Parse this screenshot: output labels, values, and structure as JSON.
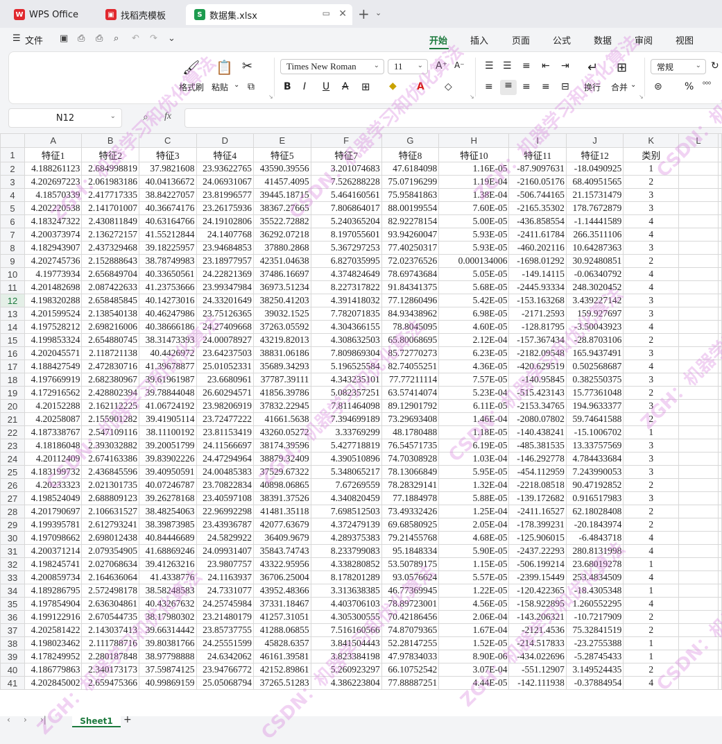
{
  "tabs": [
    {
      "label": "WPS Office",
      "icon": "wps-logo-icon",
      "color": "#e0282e"
    },
    {
      "label": "找稻壳模板",
      "icon": "docer-logo-icon",
      "color": "#e0282e"
    },
    {
      "label": "数据集.xlsx",
      "icon": "spreadsheet-icon",
      "color": "#1d9b4f"
    }
  ],
  "menu": {
    "file": "文件",
    "items": [
      "开始",
      "插入",
      "页面",
      "公式",
      "数据",
      "审阅",
      "视图"
    ],
    "active": "开始"
  },
  "ribbon": {
    "format_painter": "格式刷",
    "paste": "粘贴",
    "font_name": "Times New Roman",
    "font_size": "11",
    "wrap": "换行",
    "merge": "合并",
    "number_format": "常规",
    "percent": "%"
  },
  "formula_bar": {
    "cell_ref": "N12",
    "fx": "fx",
    "value": ""
  },
  "grid": {
    "columns": [
      "A",
      "B",
      "C",
      "D",
      "E",
      "F",
      "G",
      "H",
      "I",
      "J",
      "K",
      "L"
    ],
    "selected_row": 12,
    "rows": [
      [
        "特征1",
        "特征2",
        "特征3",
        "特征4",
        "特征5",
        "特征7",
        "特征8",
        "特征10",
        "特征11",
        "特征12",
        "类别"
      ],
      [
        "4.188261123",
        "2.684998819",
        "37.9821608",
        "23.93622765",
        "43590.39556",
        "3.201074683",
        "47.6184098",
        "1.16E-05",
        "-87.9097631",
        "-18.0490925",
        "1"
      ],
      [
        "4.202697223",
        "2.061983186",
        "40.04136672",
        "24.06931067",
        "41457.4095",
        "7.526288228",
        "75.07196299",
        "1.19E-04",
        "-2160.05176",
        "68.40951565",
        "2"
      ],
      [
        "4.18570339",
        "2.417717335",
        "38.84227057",
        "23.81996577",
        "39445.18715",
        "5.464160561",
        "75.95841863",
        "1.38E-04",
        "-506.744165",
        "21.15731479",
        "3"
      ],
      [
        "4.202220538",
        "2.141701007",
        "40.36674176",
        "23.26175936",
        "38367.27665",
        "7.806864017",
        "88.00199554",
        "7.60E-05",
        "-2165.35302",
        "178.7672879",
        "3"
      ],
      [
        "4.183247322",
        "2.430811849",
        "40.63164766",
        "24.19102806",
        "35522.72882",
        "5.240365204",
        "82.92278154",
        "5.00E-05",
        "-436.858554",
        "-1.14441589",
        "4"
      ],
      [
        "4.200373974",
        "2.136272157",
        "41.55212844",
        "24.1407768",
        "36292.07218",
        "8.197055601",
        "93.94260047",
        "5.93E-05",
        "-2411.61784",
        "266.3511106",
        "4"
      ],
      [
        "4.182943907",
        "2.437329468",
        "39.18225957",
        "23.94684853",
        "37880.2868",
        "5.367297253",
        "77.40250317",
        "5.93E-05",
        "-460.202116",
        "10.64287363",
        "3"
      ],
      [
        "4.202745736",
        "2.152888643",
        "38.78749983",
        "23.18977957",
        "42351.04638",
        "6.827035995",
        "72.02376526",
        "0.000134006",
        "-1698.01292",
        "30.92480851",
        "2"
      ],
      [
        "4.19773934",
        "2.656849704",
        "40.33650561",
        "24.22821369",
        "37486.16697",
        "4.374824649",
        "78.69743684",
        "5.05E-05",
        "-149.14115",
        "-0.06340792",
        "4"
      ],
      [
        "4.201482698",
        "2.087422633",
        "41.23753666",
        "23.99347984",
        "36973.51234",
        "8.227317822",
        "91.84341375",
        "5.68E-05",
        "-2445.93334",
        "248.3020452",
        "4"
      ],
      [
        "4.198320288",
        "2.658485845",
        "40.14273016",
        "24.33201649",
        "38250.41203",
        "4.391418032",
        "77.12860496",
        "5.42E-05",
        "-153.163268",
        "3.439227142",
        "3"
      ],
      [
        "4.201599524",
        "2.138540138",
        "40.46247986",
        "23.75126365",
        "39032.1525",
        "7.782071835",
        "84.93438962",
        "6.98E-05",
        "-2171.2593",
        "159.927697",
        "3"
      ],
      [
        "4.197528212",
        "2.698216006",
        "40.38666186",
        "24.27409668",
        "37263.05592",
        "4.304366155",
        "78.8045095",
        "4.60E-05",
        "-128.81795",
        "-3.50043923",
        "4"
      ],
      [
        "4.199853324",
        "2.654880745",
        "38.31473393",
        "24.00078927",
        "43219.82013",
        "4.308632503",
        "65.80068695",
        "2.12E-04",
        "-157.367434",
        "-28.8703106",
        "2"
      ],
      [
        "4.202045571",
        "2.118721138",
        "40.4426972",
        "23.64237503",
        "38831.06186",
        "7.809869304",
        "85.72770273",
        "6.23E-05",
        "-2182.09548",
        "165.9437491",
        "3"
      ],
      [
        "4.188427549",
        "2.472830716",
        "41.39678877",
        "25.01052331",
        "35689.34293",
        "5.196525584",
        "82.74055251",
        "4.36E-05",
        "-420.629519",
        "0.502568687",
        "4"
      ],
      [
        "4.197669919",
        "2.682380967",
        "39.61961987",
        "23.6680961",
        "37787.39111",
        "4.343235101",
        "77.77211114",
        "7.57E-05",
        "-140.95845",
        "0.382550375",
        "3"
      ],
      [
        "4.172916562",
        "2.428802394",
        "39.78844048",
        "26.60294571",
        "41856.39786",
        "5.082357251",
        "63.57414074",
        "5.23E-04",
        "-515.423143",
        "15.77361048",
        "2"
      ],
      [
        "4.20152288",
        "2.162112225",
        "41.06724192",
        "23.98206919",
        "37832.22945",
        "7.811464098",
        "89.12901792",
        "6.11E-05",
        "-2153.34765",
        "194.9633377",
        "3"
      ],
      [
        "4.20258087",
        "2.155901282",
        "39.41905114",
        "23.72477222",
        "41661.5638",
        "7.394699189",
        "73.29693408",
        "1.46E-04",
        "-2080.07802",
        "59.74641588",
        "2"
      ],
      [
        "4.187338767",
        "2.547109116",
        "38.11100192",
        "23.81153419",
        "43260.05272",
        "3.33769299",
        "48.1780488",
        "1.18E-05",
        "-140.438241",
        "-15.1006702",
        "1"
      ],
      [
        "4.18186048",
        "2.393032882",
        "39.20051799",
        "24.11566697",
        "38174.39596",
        "5.427718819",
        "76.54571735",
        "6.19E-05",
        "-485.381535",
        "13.33757569",
        "3"
      ],
      [
        "4.20112409",
        "2.674163386",
        "39.83902226",
        "24.47294964",
        "38879.32409",
        "4.390510896",
        "74.70308928",
        "1.03E-04",
        "-146.292778",
        "4.784433684",
        "3"
      ],
      [
        "4.183199732",
        "2.436845596",
        "39.40950591",
        "24.00485383",
        "37529.67322",
        "5.348065217",
        "78.13066849",
        "5.95E-05",
        "-454.112959",
        "7.243990053",
        "3"
      ],
      [
        "4.20233323",
        "2.021301735",
        "40.07246787",
        "23.70822834",
        "40898.06865",
        "7.67269559",
        "78.28329141",
        "1.32E-04",
        "-2218.08518",
        "90.47192852",
        "2"
      ],
      [
        "4.198524049",
        "2.688809123",
        "39.26278168",
        "23.40597108",
        "38391.37526",
        "4.340820459",
        "77.1884978",
        "5.88E-05",
        "-139.172682",
        "0.916517983",
        "3"
      ],
      [
        "4.201790697",
        "2.106631527",
        "38.48254063",
        "22.96992298",
        "41481.35118",
        "7.698512503",
        "73.49332426",
        "1.25E-04",
        "-2411.16527",
        "62.18028408",
        "2"
      ],
      [
        "4.199395781",
        "2.612793241",
        "38.39873985",
        "23.43936787",
        "42077.63679",
        "4.372479139",
        "69.68580925",
        "2.05E-04",
        "-178.399231",
        "-20.1843974",
        "2"
      ],
      [
        "4.197098662",
        "2.698012438",
        "40.84446689",
        "24.5829922",
        "36409.9679",
        "4.289375383",
        "79.21455768",
        "4.68E-05",
        "-125.906015",
        "-6.4843718",
        "4"
      ],
      [
        "4.200371214",
        "2.079354905",
        "41.68869246",
        "24.09931407",
        "35843.74743",
        "8.233799083",
        "95.1848334",
        "5.90E-05",
        "-2437.22293",
        "280.8131998",
        "4"
      ],
      [
        "4.198245741",
        "2.027068634",
        "39.41263216",
        "23.9807757",
        "43322.95956",
        "4.338280852",
        "53.50789175",
        "1.15E-05",
        "-506.199214",
        "23.68019278",
        "1"
      ],
      [
        "4.200859734",
        "2.164636064",
        "41.4338776",
        "24.1163937",
        "36706.25004",
        "8.178201289",
        "93.0576624",
        "5.57E-05",
        "-2399.15449",
        "253.4834509",
        "4"
      ],
      [
        "4.189286795",
        "2.572498178",
        "38.58248583",
        "24.7331077",
        "43952.48366",
        "3.313638385",
        "46.77369945",
        "1.22E-05",
        "-120.422365",
        "-18.4305348",
        "1"
      ],
      [
        "4.197854904",
        "2.636304861",
        "40.43267632",
        "24.25745984",
        "37331.18467",
        "4.403706103",
        "78.89723001",
        "4.56E-05",
        "-158.922895",
        "1.260552295",
        "4"
      ],
      [
        "4.199122916",
        "2.670544735",
        "38.17980302",
        "23.21480179",
        "41257.31051",
        "4.305300555",
        "70.42186456",
        "2.06E-04",
        "-143.206321",
        "-10.7217909",
        "2"
      ],
      [
        "4.202581422",
        "2.143037413",
        "39.66314442",
        "23.85737755",
        "41288.06855",
        "7.516160566",
        "74.87079365",
        "1.67E-04",
        "-2121.4536",
        "75.32841519",
        "2"
      ],
      [
        "4.198023462",
        "2.111788716",
        "39.80381766",
        "24.25551599",
        "45828.6357",
        "3.841504443",
        "52.28147255",
        "1.52E-05",
        "-214.517833",
        "-23.2755388",
        "1"
      ],
      [
        "4.178249952",
        "2.280187848",
        "38.97798888",
        "24.6342062",
        "46161.39581",
        "3.823384198",
        "47.97834033",
        "8.90E-06",
        "-434.022696",
        "-5.28745433",
        "1"
      ],
      [
        "4.186779863",
        "2.340173173",
        "37.59874125",
        "23.94766772",
        "42152.89861",
        "5.260923297",
        "66.10752542",
        "3.07E-04",
        "-551.12907",
        "3.149524435",
        "2"
      ],
      [
        "4.202845002",
        "2.659475366",
        "40.99869159",
        "25.05068794",
        "37265.51283",
        "4.386223804",
        "77.88887251",
        "4.44E-05",
        "-142.111938",
        "-0.37884954",
        "4"
      ]
    ]
  },
  "sheets": [
    "Sheet1"
  ],
  "watermarks": [
    "ZGH：机器学习和优化算法",
    "CSDN：机器学习和优化算法"
  ]
}
